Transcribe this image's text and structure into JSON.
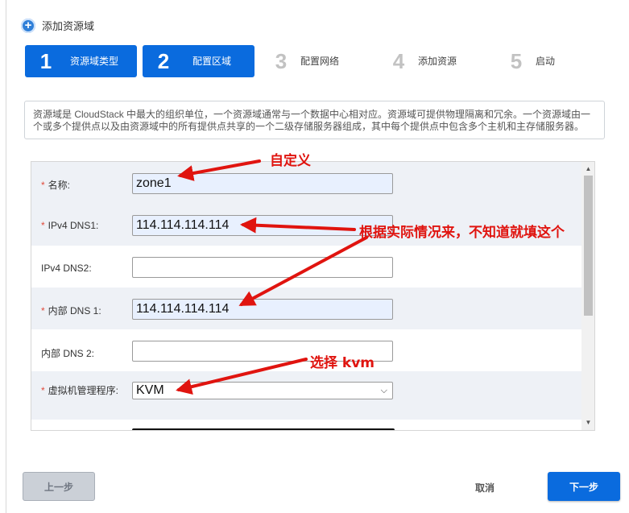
{
  "dialog": {
    "title": "添加资源域",
    "icon": "plus-circle-icon"
  },
  "steps": [
    {
      "num": "1",
      "label": "资源域类型",
      "state": "done"
    },
    {
      "num": "2",
      "label": "配置区域",
      "state": "active"
    },
    {
      "num": "3",
      "label": "配置网络",
      "state": "inactive"
    },
    {
      "num": "4",
      "label": "添加资源",
      "state": "inactive"
    },
    {
      "num": "5",
      "label": "启动",
      "state": "inactive"
    }
  ],
  "info_text": "资源域是 CloudStack 中最大的组织单位，一个资源域通常与一个数据中心相对应。资源域可提供物理隔离和冗余。一个资源域由一个或多个提供点以及由资源域中的所有提供点共享的一个二级存储服务器组成，其中每个提供点中包含多个主机和主存储服务器。",
  "form": {
    "name": {
      "label": "名称:",
      "required": true,
      "value": "zone1"
    },
    "ipv4_dns1": {
      "label": "IPv4 DNS1:",
      "required": true,
      "value": "114.114.114.114"
    },
    "ipv4_dns2": {
      "label": "IPv4 DNS2:",
      "required": false,
      "value": ""
    },
    "internal_dns1": {
      "label": "内部 DNS 1:",
      "required": true,
      "value": "114.114.114.114"
    },
    "internal_dns2": {
      "label": "内部 DNS 2:",
      "required": false,
      "value": ""
    },
    "hypervisor": {
      "label": "虚拟机管理程序:",
      "required": true,
      "value": "KVM"
    }
  },
  "annotations": {
    "custom": "自定义",
    "dns_hint": "根据实际情况来，不知道就填这个",
    "select_kvm": "选择 kvm"
  },
  "buttons": {
    "prev": "上一步",
    "cancel": "取消",
    "next": "下一步"
  },
  "colors": {
    "accent": "#0a6bde",
    "annotation": "#e0140f",
    "required": "#e14b3b"
  }
}
